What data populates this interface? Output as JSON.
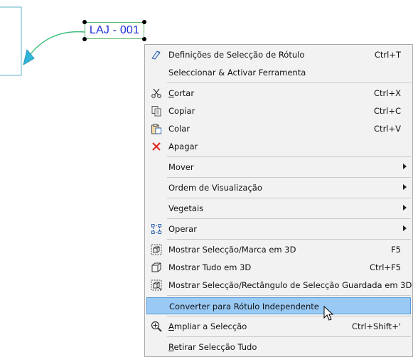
{
  "drawing": {
    "label_text": "LAJ - 001"
  },
  "context_menu": {
    "items": [
      {
        "label": "Definições de Selecção de Rótulo",
        "shortcut": "Ctrl+T",
        "icon": "label-settings-icon"
      },
      {
        "label": "Seleccionar & Activar Ferramenta",
        "shortcut": ""
      },
      {
        "label": "Cortar",
        "shortcut": "Ctrl+X",
        "icon": "scissors-icon"
      },
      {
        "label": "Copiar",
        "shortcut": "Ctrl+C",
        "icon": "copy-icon"
      },
      {
        "label": "Colar",
        "shortcut": "Ctrl+V",
        "icon": "paste-icon"
      },
      {
        "label": "Apagar",
        "shortcut": "",
        "icon": "delete-x-icon"
      },
      {
        "label": "Mover",
        "submenu": true
      },
      {
        "label": "Ordem de Visualização",
        "submenu": true
      },
      {
        "label": "Vegetais",
        "submenu": true
      },
      {
        "label": "Operar",
        "submenu": true,
        "icon": "operate-icon"
      },
      {
        "label": "Mostrar Selecção/Marca em 3D",
        "shortcut": "F5",
        "icon": "show-3d-selection-icon"
      },
      {
        "label": "Mostrar Tudo em 3D",
        "shortcut": "Ctrl+F5",
        "icon": "cube-icon"
      },
      {
        "label": "Mostrar Selecção/Rectângulo de Selecção Guardada em 3D",
        "shortcut": "",
        "icon": "show-3d-marquee-icon"
      },
      {
        "label": "Converter para Rótulo Independente",
        "shortcut": "",
        "highlighted": true
      },
      {
        "label": "Ampliar a Selecção",
        "shortcut": "Ctrl+Shift+'",
        "icon": "zoom-selection-icon"
      },
      {
        "label": "Retirar Selecção Tudo",
        "shortcut": ""
      }
    ]
  },
  "colors": {
    "label_text": "#1f2fd6",
    "label_border": "#5bb76b",
    "leader_line": "#3cc07a",
    "arrow_head": "#2fb5d8",
    "highlight": "#99c9f5",
    "delete_icon": "#e0261d"
  }
}
